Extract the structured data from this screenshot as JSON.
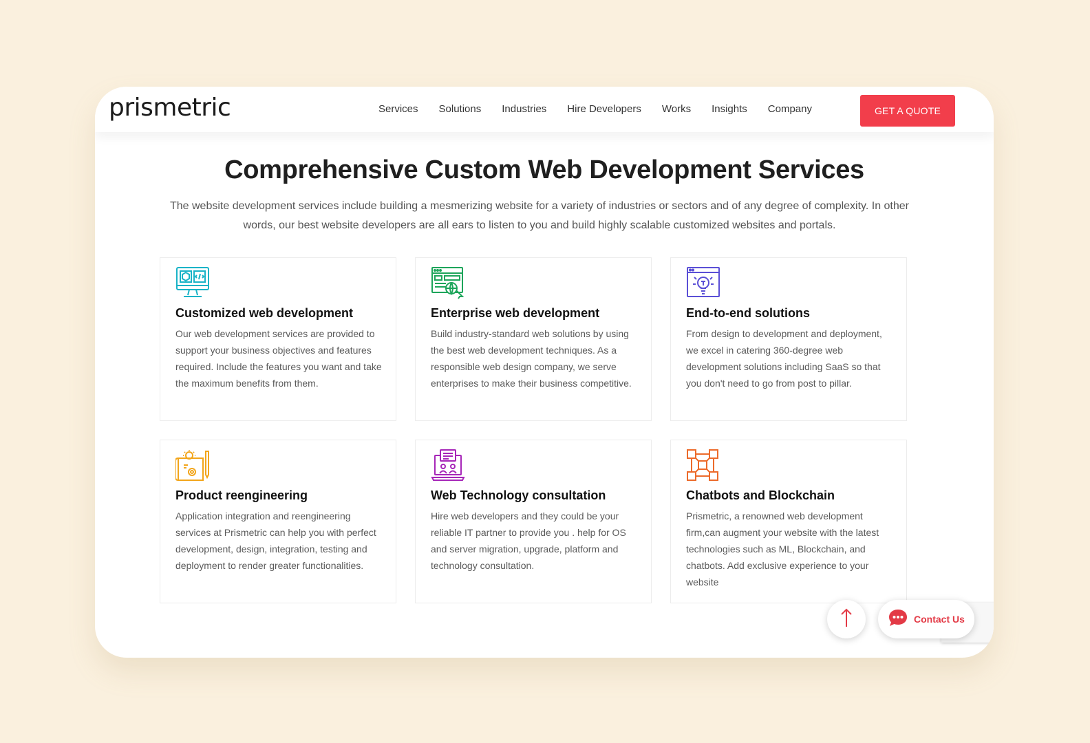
{
  "brand": {
    "logo_text": "prismetric"
  },
  "nav": {
    "items": [
      "Services",
      "Solutions",
      "Industries",
      "Hire Developers",
      "Works",
      "Insights",
      "Company"
    ],
    "cta_label": "GET A QUOTE"
  },
  "hero": {
    "title": "Comprehensive Custom Web Development Services",
    "subtitle": "The website development services include building a mesmerizing website for a variety of industries or sectors and of any degree of complexity. In other words, our best website developers are all ears to listen to you and build highly scalable customized websites and portals."
  },
  "cards": [
    {
      "title": "Customized web development",
      "text": "Our web development services are provided to support your business objectives and features required. Include the features you want and take the maximum benefits from them.",
      "icon": "monitor-code-icon",
      "color": "#19b3c7"
    },
    {
      "title": "Enterprise web development",
      "text": "Build industry-standard web solutions by using the best web development techniques. As a responsible web design company, we serve enterprises to make their business competitive.",
      "icon": "web-globe-icon",
      "color": "#1da55a"
    },
    {
      "title": "End-to-end solutions",
      "text": "From design to development and deployment, we excel in catering 360-degree web development solutions including SaaS so that you don't need to go from post to pillar.",
      "icon": "browser-bulb-icon",
      "color": "#5a4fd6"
    },
    {
      "title": "Product reengineering",
      "text": "Application integration and reengineering services at Prismetric can help you with perfect development, design, integration, testing and deployment to render greater functionalities.",
      "icon": "blueprint-gear-icon",
      "color": "#f2a51a"
    },
    {
      "title": "Web Technology consultation",
      "text": "Hire web developers and they could be your reliable IT partner to provide you . help for OS and server migration, upgrade, platform and technology consultation.",
      "icon": "laptop-chat-icon",
      "color": "#a626b8"
    },
    {
      "title": "Chatbots and Blockchain",
      "text": "Prismetric, a renowned web development firm,can augment your website with the latest technologies such as ML, Blockchain, and chatbots. Add exclusive experience to your website",
      "icon": "blockchain-icon",
      "color": "#ec6a2a"
    }
  ],
  "widgets": {
    "contact_label": "Contact Us",
    "accent": "#f23e4b"
  }
}
